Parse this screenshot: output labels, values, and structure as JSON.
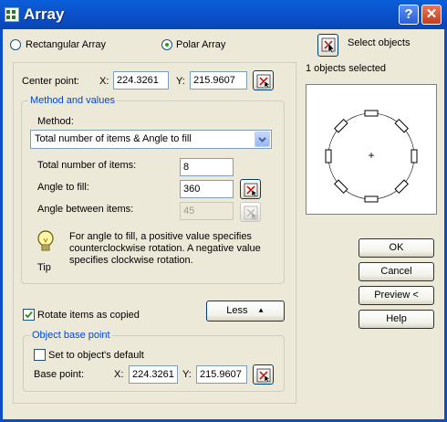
{
  "window": {
    "title": "Array",
    "help_glyph": "?",
    "close_glyph": "✕"
  },
  "mode": {
    "rectangular_label": "Rectangular Array",
    "polar_label": "Polar Array",
    "selected": "polar"
  },
  "selection": {
    "select_label": "Select objects",
    "count_text": "1 objects selected"
  },
  "center_point": {
    "label": "Center point:",
    "x_label": "X:",
    "x_value": "224.3261",
    "y_label": "Y:",
    "y_value": "215.9607"
  },
  "method_group": {
    "title": "Method and values",
    "method_label": "Method:",
    "method_value": "Total number of items & Angle to fill",
    "total_items_label": "Total number of items:",
    "total_items_value": "8",
    "angle_fill_label": "Angle to fill:",
    "angle_fill_value": "360",
    "angle_between_label": "Angle between items:",
    "angle_between_value": "45"
  },
  "tip": {
    "label": "Tip",
    "text": "For angle to fill, a positive value specifies counterclockwise rotation.  A negative value specifies clockwise rotation."
  },
  "rotate_items": {
    "label": "Rotate items as copied",
    "checked": true
  },
  "less_button": {
    "label": "Less",
    "arrow": "⯅"
  },
  "base_point_group": {
    "title": "Object base point",
    "default_label": "Set to object's default",
    "default_checked": false,
    "base_label": "Base point:",
    "x_label": "X:",
    "x_value": "224.3261",
    "y_label": "Y:",
    "y_value": "215.9607"
  },
  "buttons": {
    "ok": "OK",
    "cancel": "Cancel",
    "preview": "Preview <",
    "help": "Help"
  },
  "preview": {
    "center_mark": "+",
    "item_count": 8
  },
  "colors": {
    "title_bar": "#0a4fc8",
    "group_label": "#0046d5",
    "face": "#ece9d8"
  }
}
